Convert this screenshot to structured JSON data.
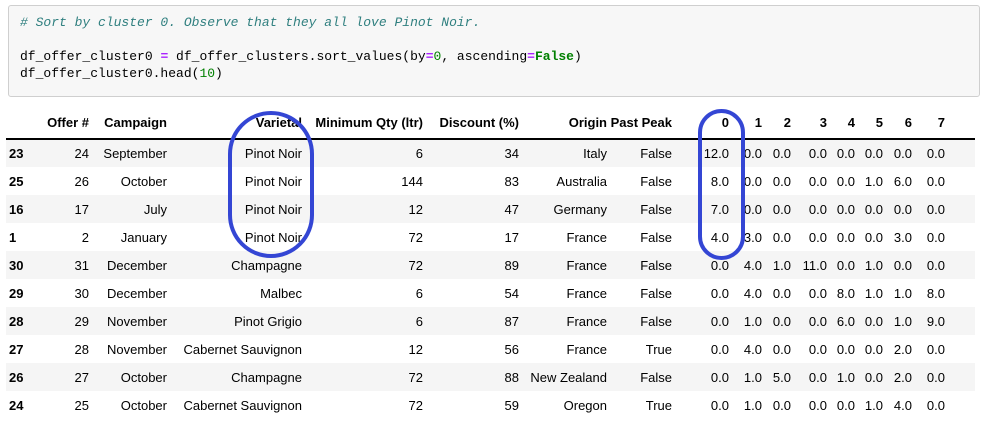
{
  "code_cell": {
    "language": "python",
    "lines": [
      [
        {
          "text": "# Sort by cluster 0. Observe that they all love Pinot Noir.",
          "style": "comment"
        }
      ],
      [],
      [
        {
          "text": "df_offer_cluster0 ",
          "style": "plain"
        },
        {
          "text": "=",
          "style": "operator"
        },
        {
          "text": " df_offer_clusters.sort_values(by",
          "style": "plain"
        },
        {
          "text": "=",
          "style": "operator"
        },
        {
          "text": "0",
          "style": "number"
        },
        {
          "text": ", ascending",
          "style": "plain"
        },
        {
          "text": "=",
          "style": "operator"
        },
        {
          "text": "False",
          "style": "keyword"
        },
        {
          "text": ")",
          "style": "plain"
        }
      ],
      [
        {
          "text": "df_offer_cluster0.head(",
          "style": "plain"
        },
        {
          "text": "10",
          "style": "number"
        },
        {
          "text": ")",
          "style": "plain"
        }
      ]
    ]
  },
  "table": {
    "columns": [
      "",
      "Offer #",
      "Campaign",
      "Varietal",
      "Minimum Qty (ltr)",
      "Discount (%)",
      "Origin",
      "Past Peak",
      "0",
      "1",
      "2",
      "3",
      "4",
      "5",
      "6",
      "7"
    ],
    "rows": [
      {
        "index": "23",
        "cells": [
          "24",
          "September",
          "Pinot Noir",
          "6",
          "34",
          "Italy",
          "False",
          "12.0",
          "0.0",
          "0.0",
          "0.0",
          "0.0",
          "0.0",
          "0.0",
          "0.0"
        ]
      },
      {
        "index": "25",
        "cells": [
          "26",
          "October",
          "Pinot Noir",
          "144",
          "83",
          "Australia",
          "False",
          "8.0",
          "0.0",
          "0.0",
          "0.0",
          "0.0",
          "1.0",
          "6.0",
          "0.0"
        ]
      },
      {
        "index": "16",
        "cells": [
          "17",
          "July",
          "Pinot Noir",
          "12",
          "47",
          "Germany",
          "False",
          "7.0",
          "0.0",
          "0.0",
          "0.0",
          "0.0",
          "0.0",
          "0.0",
          "0.0"
        ]
      },
      {
        "index": "1",
        "cells": [
          "2",
          "January",
          "Pinot Noir",
          "72",
          "17",
          "France",
          "False",
          "4.0",
          "3.0",
          "0.0",
          "0.0",
          "0.0",
          "0.0",
          "3.0",
          "0.0"
        ]
      },
      {
        "index": "30",
        "cells": [
          "31",
          "December",
          "Champagne",
          "72",
          "89",
          "France",
          "False",
          "0.0",
          "4.0",
          "1.0",
          "11.0",
          "0.0",
          "1.0",
          "0.0",
          "0.0"
        ]
      },
      {
        "index": "29",
        "cells": [
          "30",
          "December",
          "Malbec",
          "6",
          "54",
          "France",
          "False",
          "0.0",
          "4.0",
          "0.0",
          "0.0",
          "8.0",
          "1.0",
          "1.0",
          "8.0"
        ]
      },
      {
        "index": "28",
        "cells": [
          "29",
          "November",
          "Pinot Grigio",
          "6",
          "87",
          "France",
          "False",
          "0.0",
          "1.0",
          "0.0",
          "0.0",
          "6.0",
          "0.0",
          "1.0",
          "9.0"
        ]
      },
      {
        "index": "27",
        "cells": [
          "28",
          "November",
          "Cabernet Sauvignon",
          "12",
          "56",
          "France",
          "True",
          "0.0",
          "4.0",
          "0.0",
          "0.0",
          "0.0",
          "0.0",
          "2.0",
          "0.0"
        ]
      },
      {
        "index": "26",
        "cells": [
          "27",
          "October",
          "Champagne",
          "72",
          "88",
          "New Zealand",
          "False",
          "0.0",
          "1.0",
          "5.0",
          "0.0",
          "1.0",
          "0.0",
          "2.0",
          "0.0"
        ]
      },
      {
        "index": "24",
        "cells": [
          "25",
          "October",
          "Cabernet Sauvignon",
          "72",
          "59",
          "Oregon",
          "True",
          "0.0",
          "1.0",
          "0.0",
          "0.0",
          "0.0",
          "1.0",
          "4.0",
          "0.0"
        ]
      }
    ]
  },
  "annotations": {
    "highlight_color": "#3446d4",
    "items": [
      {
        "name": "varietal-circle",
        "marks": "Varietal header and the four Pinot Noir values"
      },
      {
        "name": "cluster0-circle",
        "marks": "Cluster 0 column values 12.0 / 8.0 / 7.0 / 4.0"
      }
    ]
  },
  "colors": {
    "comment": "#2f7f7f",
    "operator": "#AA22FF",
    "number": "#008000",
    "keyword": "#008000",
    "cell_bg": "#f7f7f7",
    "cell_border": "#cfcfcf",
    "row_stripe": "#f5f5f5",
    "header_rule": "#000000"
  }
}
